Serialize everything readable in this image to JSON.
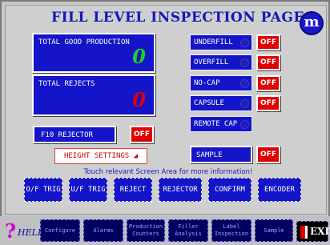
{
  "header": {
    "title": "FILL LEVEL INSPECTION PAGE",
    "logo_glyph": "m"
  },
  "counters": {
    "good": {
      "label": "TOTAL GOOD PRODUCTION",
      "value": "0",
      "color": "#20d020"
    },
    "rejects": {
      "label": "TOTAL REJECTS",
      "value": "0",
      "color": "#e00000"
    }
  },
  "inspections": [
    {
      "label": "UNDERFILL",
      "state": "OFF"
    },
    {
      "label": "OVERFILL",
      "state": "OFF"
    },
    {
      "label": "NO-CAP",
      "state": "OFF"
    },
    {
      "label": "CAPSULE",
      "state": "OFF"
    },
    {
      "label": "REMOTE CAP"
    }
  ],
  "rejector": {
    "label": "F10 REJECTOR",
    "state": "OFF"
  },
  "height_settings": {
    "label": "HEIGHT SETTINGS"
  },
  "sample": {
    "label": "SAMPLE",
    "state": "OFF"
  },
  "hint": "Touch relevant Screen Area for more information!",
  "triggers": [
    "O/F TRIG",
    "U/F TRIG",
    "REJECT",
    "REJECTOR",
    "CONFIRM",
    "ENCODER"
  ],
  "nav": {
    "help": "HELP",
    "items": [
      "Configure",
      "Alarms",
      "Production Counters",
      "Filler Analysis",
      "Label Inspection",
      "Sample"
    ],
    "exit": "EXIT"
  },
  "colors": {
    "panel_blue": "#1414c8",
    "off_red": "#e00000",
    "title_blue": "#1717b8"
  }
}
